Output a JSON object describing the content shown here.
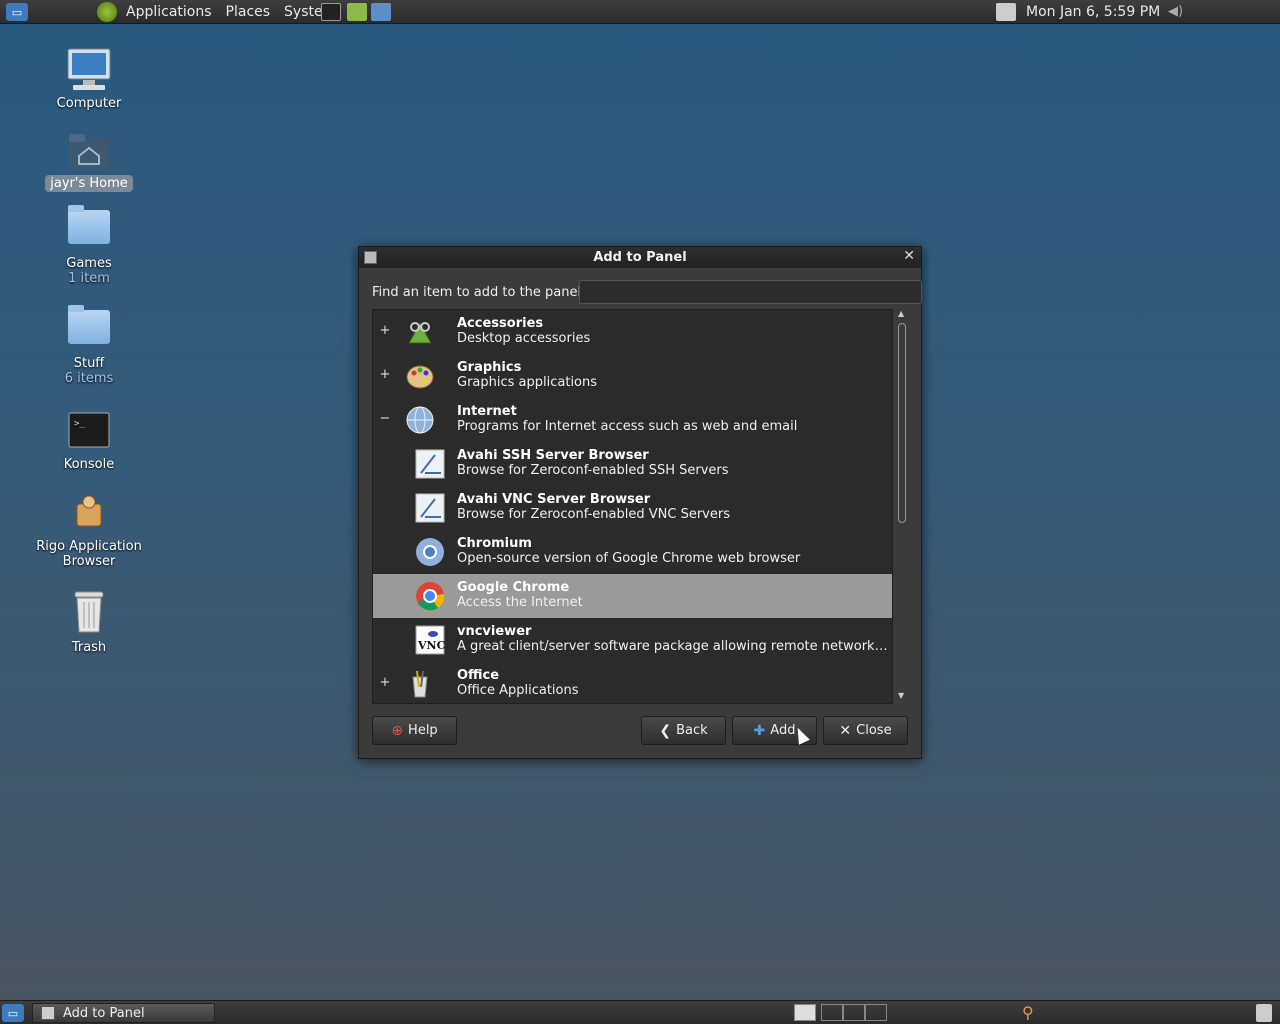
{
  "top_panel": {
    "menus": [
      "Applications",
      "Places",
      "System"
    ],
    "clock": "Mon Jan  6,  5:59 PM"
  },
  "desktop": {
    "icons": [
      {
        "label": "Computer",
        "sub": ""
      },
      {
        "label": "jayr's Home",
        "sub": ""
      },
      {
        "label": "Games",
        "sub": "1 item"
      },
      {
        "label": "Stuff",
        "sub": "6 items"
      },
      {
        "label": "Konsole",
        "sub": ""
      },
      {
        "label": "Rigo Application Browser",
        "sub": ""
      },
      {
        "label": "Trash",
        "sub": ""
      }
    ]
  },
  "dialog": {
    "title": "Add to Panel",
    "find_label": "Find an item to add to the panel:",
    "find_value": "",
    "items": [
      {
        "name": "Accessories",
        "desc": "Desktop accessories",
        "expander": "+",
        "icon": "accessories-icon"
      },
      {
        "name": "Graphics",
        "desc": "Graphics applications",
        "expander": "+",
        "icon": "graphics-icon"
      },
      {
        "name": "Internet",
        "desc": "Programs for Internet access such as web and email",
        "expander": "−",
        "icon": "internet-icon"
      },
      {
        "name": "Avahi SSH Server Browser",
        "desc": "Browse for Zeroconf-enabled SSH Servers",
        "expander": "",
        "icon": "avahi-ssh-icon"
      },
      {
        "name": "Avahi VNC Server Browser",
        "desc": "Browse for Zeroconf-enabled VNC Servers",
        "expander": "",
        "icon": "avahi-vnc-icon"
      },
      {
        "name": "Chromium",
        "desc": "Open-source version of Google Chrome web browser",
        "expander": "",
        "icon": "chromium-icon"
      },
      {
        "name": "Google Chrome",
        "desc": "Access the Internet",
        "expander": "",
        "icon": "google-chrome-icon"
      },
      {
        "name": "vncviewer",
        "desc": "A great client/server software package allowing remote network access …",
        "expander": "",
        "icon": "vncviewer-icon"
      },
      {
        "name": "Office",
        "desc": "Office Applications",
        "expander": "+",
        "icon": "office-icon"
      }
    ],
    "buttons": {
      "help": "Help",
      "back": "Back",
      "add": "Add",
      "close": "Close"
    }
  },
  "bottom_panel": {
    "task": "Add to Panel"
  }
}
